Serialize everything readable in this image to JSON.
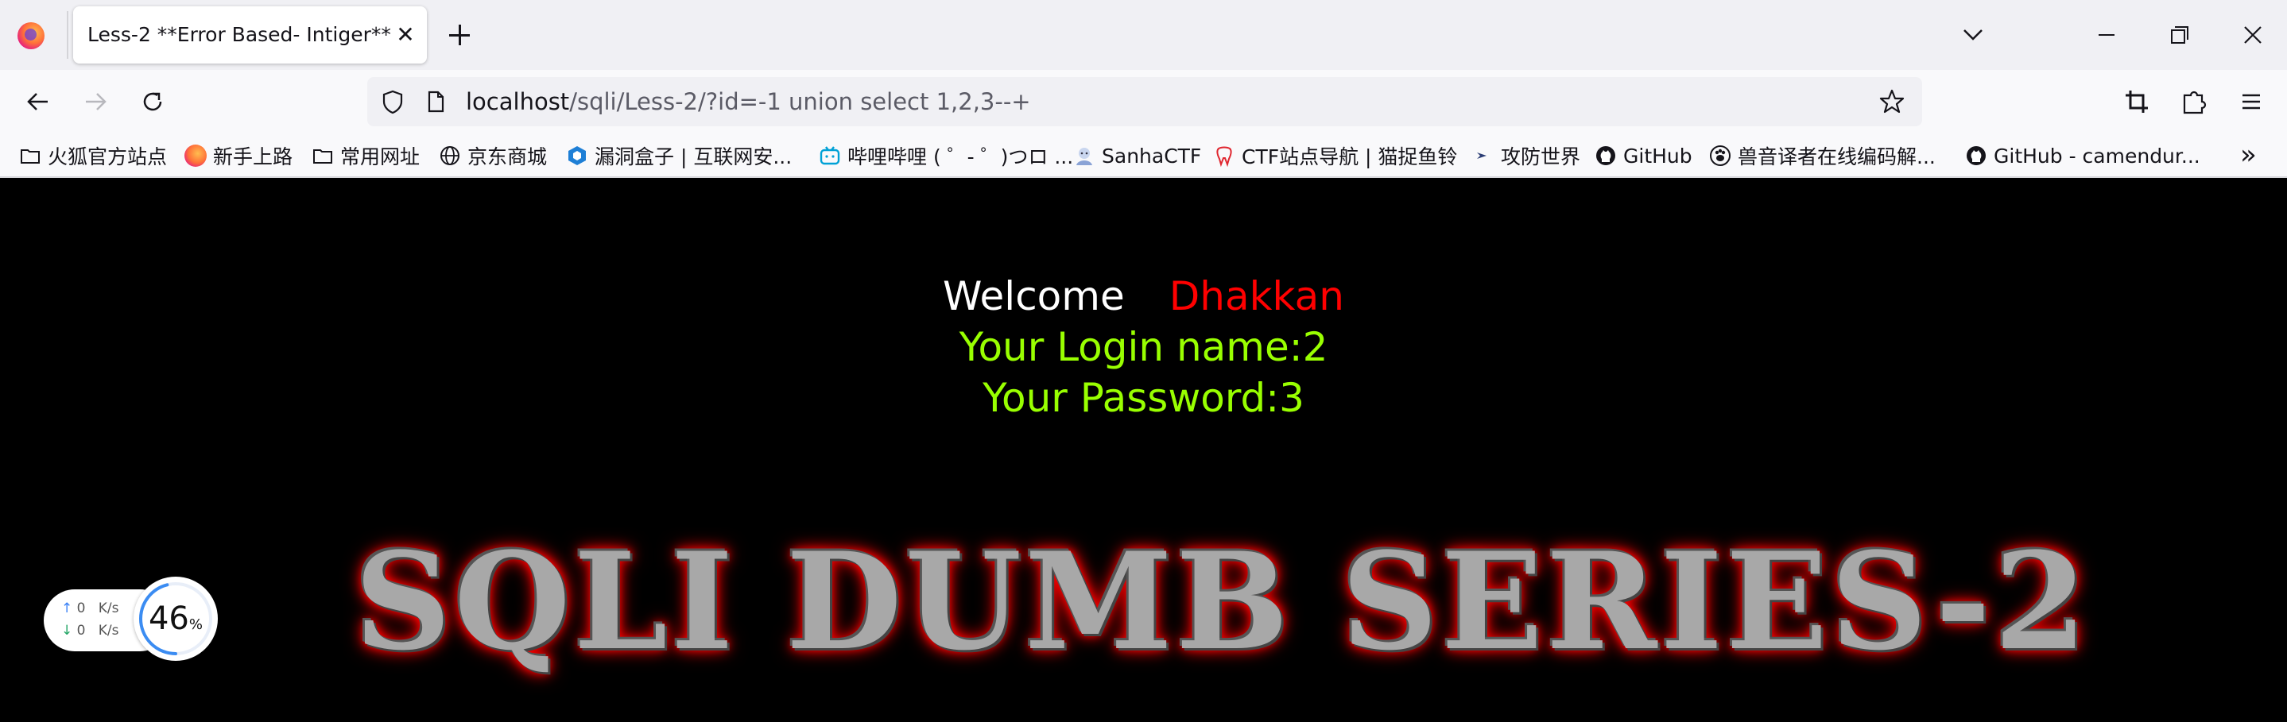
{
  "browser": {
    "tab": {
      "title": "Less-2 **Error Based- Intiger**",
      "close": "✕"
    },
    "url": {
      "host": "localhost",
      "path": "/sqli/Less-2/?id=-1 union select 1,2,3--+"
    },
    "bookmarks": [
      {
        "label": "火狐官方站点",
        "icon": "folder-icon"
      },
      {
        "label": "新手上路",
        "icon": "firefox-icon"
      },
      {
        "label": "常用网址",
        "icon": "folder-icon"
      },
      {
        "label": "京东商城",
        "icon": "globe-icon"
      },
      {
        "label": "漏洞盒子 | 互联网安...",
        "icon": "hex-icon"
      },
      {
        "label": "哔哩哔哩 ( ゜- ゜)つロ ...",
        "icon": "bilibili-icon"
      },
      {
        "label": "SanhaCTF",
        "icon": "avatar-icon"
      },
      {
        "label": "CTF站点导航 | 猫捉鱼铃",
        "icon": "tooth-icon"
      },
      {
        "label": "攻防世界",
        "icon": "arrow-icon"
      },
      {
        "label": "GitHub",
        "icon": "github-icon"
      },
      {
        "label": "兽音译者在线编码解...",
        "icon": "paw-icon"
      },
      {
        "label": "GitHub - camendur...",
        "icon": "github-icon"
      }
    ],
    "bookmarks_more": "»"
  },
  "page": {
    "welcome": "Welcome",
    "name": "Dhakkan",
    "login_line": "Your Login name:2",
    "password_line": "Your Password:3",
    "banner": "SQLI DUMB SERIES-2"
  },
  "speed_widget": {
    "up_value": "0",
    "up_unit": "K/s",
    "down_value": "0",
    "down_unit": "K/s",
    "percent": "46",
    "percent_sign": "%",
    "percent_fraction": 0.46
  },
  "colors": {
    "welcome": "#ffffff",
    "name": "#ff0000",
    "info": "#99ff00",
    "banner_glow": "#ff0000"
  }
}
